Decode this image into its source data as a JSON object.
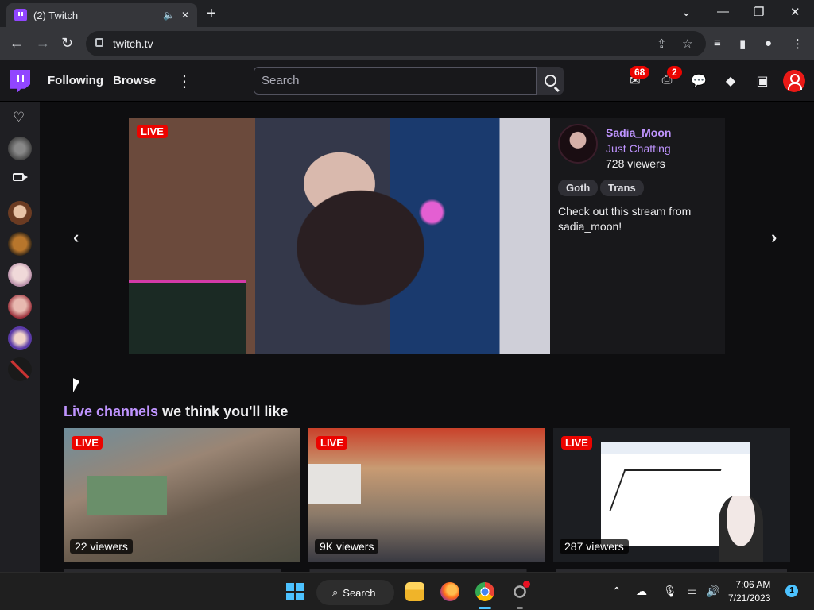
{
  "browser": {
    "tab_title": "(2) Twitch",
    "url": "twitch.tv"
  },
  "twitch_nav": {
    "following": "Following",
    "browse": "Browse",
    "search_placeholder": "Search",
    "notifications_count": "68",
    "inbox_count": "2"
  },
  "featured": {
    "live_label": "LIVE",
    "channel": "Sadia_Moon",
    "category": "Just Chatting",
    "viewers": "728 viewers",
    "tags": [
      "Goth",
      "Trans"
    ],
    "description": "Check out this stream from sadia_moon!"
  },
  "section": {
    "title_highlight": "Live channels",
    "title_rest": " we think you'll like"
  },
  "cards": [
    {
      "live": "LIVE",
      "viewers": "22 viewers"
    },
    {
      "live": "LIVE",
      "viewers": "9K viewers"
    },
    {
      "live": "LIVE",
      "viewers": "287 viewers"
    }
  ],
  "taskbar": {
    "search": "Search",
    "time": "7:06 AM",
    "date": "7/21/2023",
    "notification_count": "1"
  },
  "colors": {
    "twitch_purple": "#9146ff",
    "link_purple": "#bf94ff",
    "live_red": "#eb0400"
  }
}
